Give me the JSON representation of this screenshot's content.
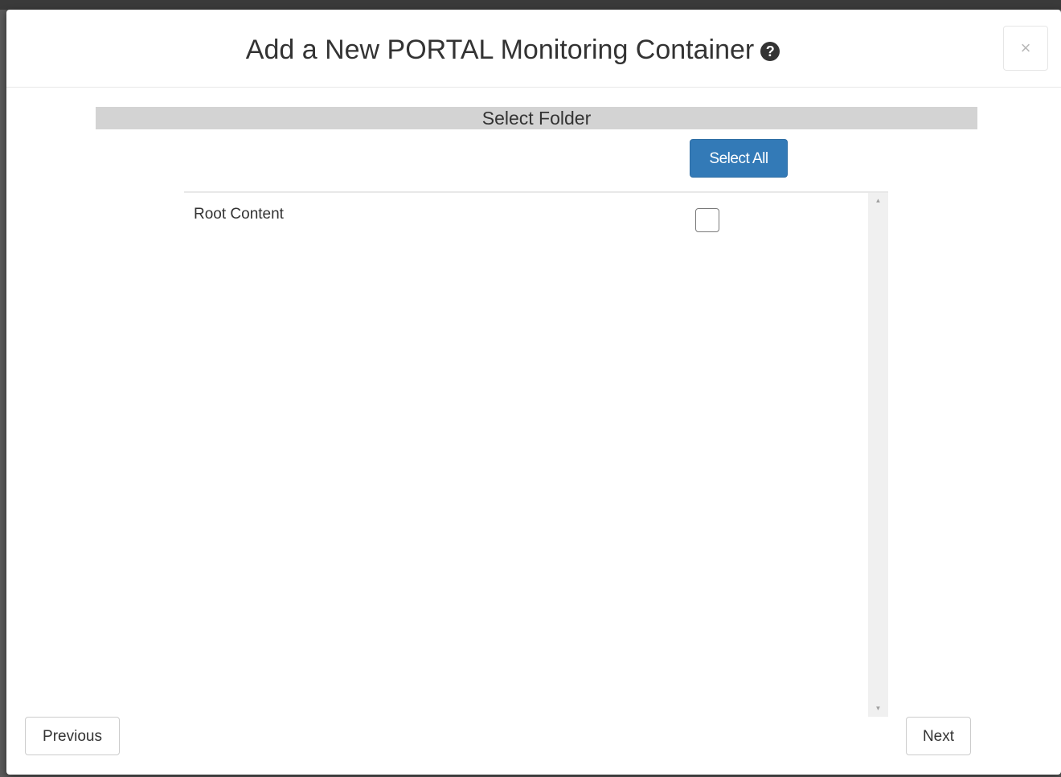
{
  "modal": {
    "title": "Add a New PORTAL Monitoring Container",
    "help_icon": "question-circle-icon",
    "help_glyph": "?",
    "close_icon": "close-icon",
    "close_glyph": "×"
  },
  "section": {
    "title": "Select Folder",
    "select_all_label": "Select All"
  },
  "folders": [
    {
      "label": "Root Content",
      "checked": false
    }
  ],
  "scrollbar": {
    "up_glyph": "▲",
    "down_glyph": "▼"
  },
  "footer": {
    "previous_label": "Previous",
    "next_label": "Next"
  },
  "colors": {
    "primary": "#337ab7",
    "section_bar": "#d3d3d3"
  }
}
